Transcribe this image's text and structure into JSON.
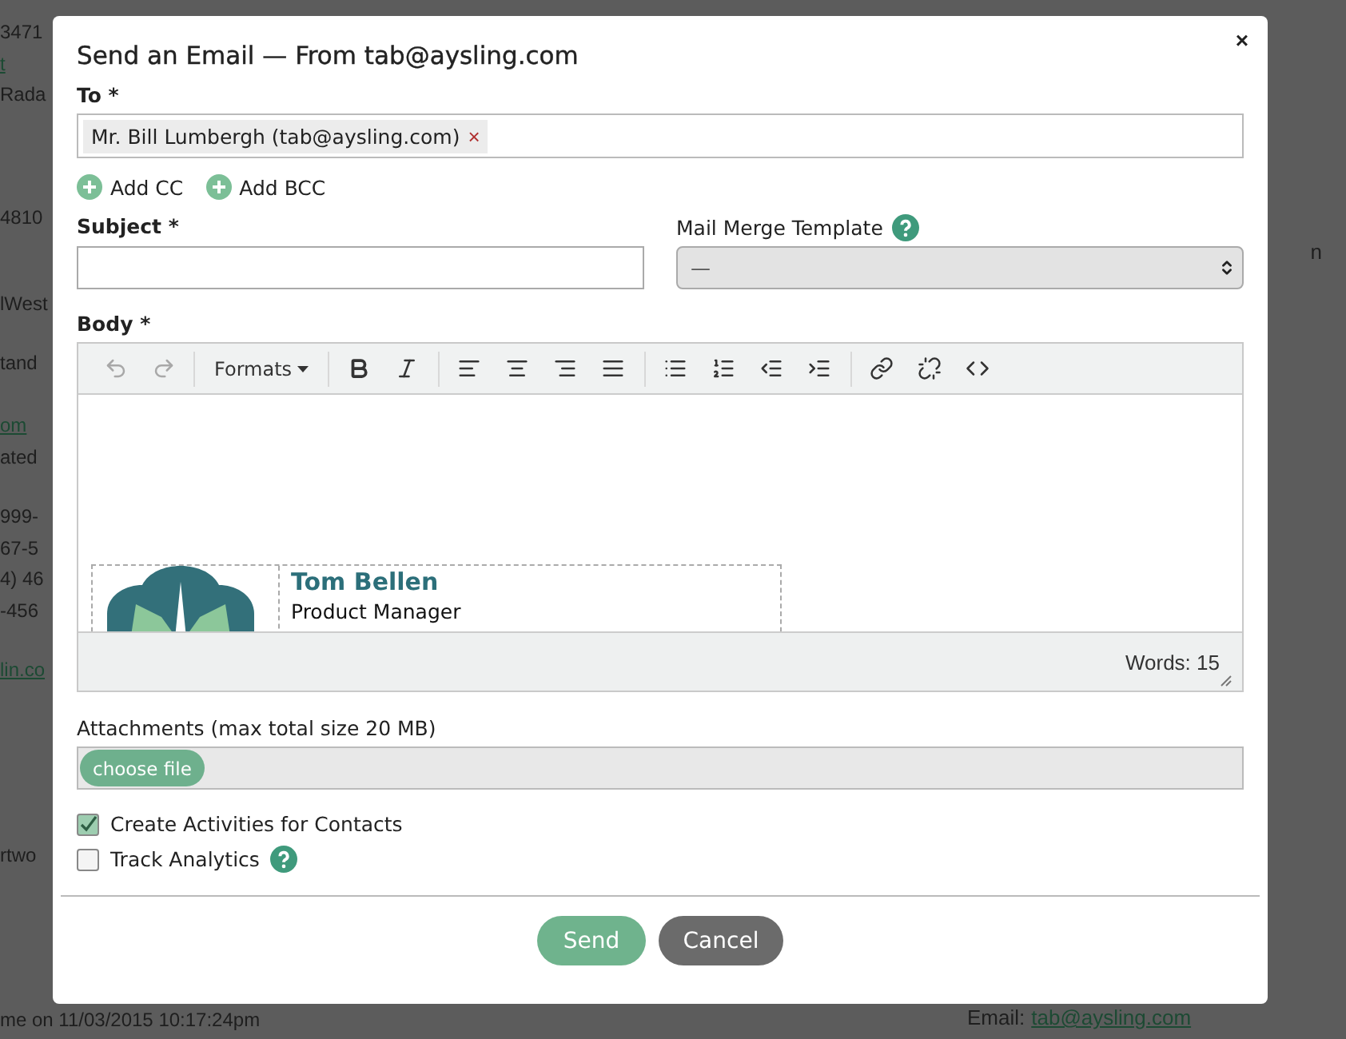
{
  "background": {
    "left_groups": [
      [
        {
          "text": "3471",
          "kind": "text"
        },
        {
          "text": "t",
          "kind": "link"
        },
        {
          "text": "Rada",
          "kind": "text"
        }
      ],
      [
        {
          "text": "4810",
          "kind": "text"
        }
      ],
      [
        {
          "text": "lWest",
          "kind": "text"
        }
      ],
      [
        {
          "text": "tand",
          "kind": "text"
        }
      ],
      [
        {
          "text": "om",
          "kind": "link"
        },
        {
          "text": "ated",
          "kind": "text"
        }
      ],
      [
        {
          "text": "999-",
          "kind": "text"
        },
        {
          "text": "67-5",
          "kind": "text"
        },
        {
          "text": "4) 46",
          "kind": "text"
        },
        {
          "text": "-456",
          "kind": "text"
        }
      ],
      [
        {
          "text": "lin.co",
          "kind": "link"
        }
      ],
      [
        {
          "text": "rtwo",
          "kind": "text"
        }
      ],
      [
        {
          "text": "me on 11/03/2015 10:17:24pm",
          "kind": "text"
        }
      ]
    ],
    "right_lines": [
      {
        "text": "n",
        "kind": "text"
      },
      {
        "label": "Email:",
        "link": "tab@aysling.com",
        "kind": "email"
      }
    ]
  },
  "dialog": {
    "title": "Send an Email — From tab@aysling.com",
    "close": "×"
  },
  "to": {
    "label": "To *",
    "recipients": [
      {
        "name": "Mr. Bill Lumbergh (tab@aysling.com)",
        "remove": "×"
      }
    ]
  },
  "add_links": [
    "Add CC",
    "Add BCC"
  ],
  "subject": {
    "label": "Subject *"
  },
  "template": {
    "label": "Mail Merge Template",
    "value": "—"
  },
  "body": {
    "label": "Body *",
    "formats": "Formats",
    "toolbar": [
      [
        {
          "kind": "undo",
          "disabled": true
        },
        {
          "kind": "redo",
          "disabled": true
        }
      ],
      [
        {
          "kind": "formats",
          "disabled": false
        }
      ],
      [
        {
          "kind": "bold",
          "disabled": false
        },
        {
          "kind": "italic",
          "disabled": false
        }
      ],
      [
        {
          "kind": "align-left",
          "disabled": false
        },
        {
          "kind": "align-center",
          "disabled": false
        },
        {
          "kind": "align-right",
          "disabled": false
        },
        {
          "kind": "align-justify",
          "disabled": false
        }
      ],
      [
        {
          "kind": "bullet-list",
          "disabled": false
        },
        {
          "kind": "numbered-list",
          "disabled": false
        },
        {
          "kind": "outdent",
          "disabled": false
        },
        {
          "kind": "indent",
          "disabled": false
        }
      ],
      [
        {
          "kind": "link",
          "disabled": false
        },
        {
          "kind": "unlink",
          "disabled": false
        },
        {
          "kind": "code",
          "disabled": false
        }
      ]
    ],
    "signature": {
      "name": "Tom Bellen",
      "title": "Product Manager"
    },
    "word_count": "Words: 15"
  },
  "attachments": {
    "label": "Attachments (max total size 20 MB)",
    "button": "choose file"
  },
  "options": [
    {
      "label": "Create Activities for Contacts",
      "checked": true,
      "help": false
    },
    {
      "label": "Track Analytics",
      "checked": false,
      "help": true
    }
  ],
  "buttons": [
    {
      "label": "Send",
      "kind": "primary"
    },
    {
      "label": "Cancel",
      "kind": "secondary"
    }
  ]
}
